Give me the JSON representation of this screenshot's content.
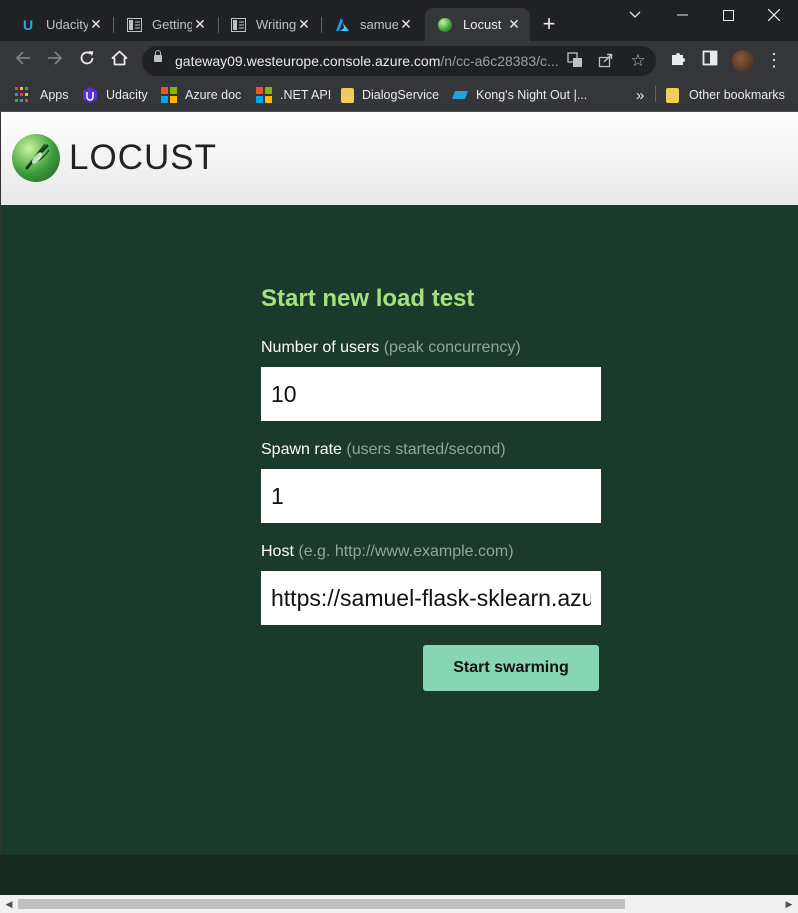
{
  "browser": {
    "tabs": [
      {
        "title": "Udacity",
        "icon": "udacity-icon"
      },
      {
        "title": "Getting",
        "icon": "doc-icon"
      },
      {
        "title": "Writing",
        "icon": "doc-icon"
      },
      {
        "title": "samuel",
        "icon": "azure-icon"
      },
      {
        "title": "Locust",
        "icon": "locust-icon",
        "active": true
      }
    ],
    "url_host": "gateway09.westeurope.console.azure.com",
    "url_rest": "/n/cc-a6c28383/c...",
    "bookmarks": [
      {
        "label": "Apps",
        "icon": "apps-grid-icon"
      },
      {
        "label": "Udacity",
        "icon": "udacity-icon"
      },
      {
        "label": "Azure doc",
        "icon": "microsoft-icon"
      },
      {
        "label": ".NET API",
        "icon": "microsoft-icon"
      },
      {
        "label": "DialogService",
        "icon": "folder-icon"
      },
      {
        "label": "Kong's Night Out |...",
        "icon": "kong-icon"
      }
    ],
    "other_bookmarks": "Other bookmarks",
    "overflow": "»"
  },
  "header": {
    "logo_text": "LOCUST"
  },
  "form": {
    "title": "Start new load test",
    "users_label": "Number of users",
    "users_hint": "(peak concurrency)",
    "users_value": "10",
    "spawn_label": "Spawn rate",
    "spawn_hint": "(users started/second)",
    "spawn_value": "1",
    "host_label": "Host",
    "host_hint": "(e.g. http://www.example.com)",
    "host_value": "https://samuel-flask-sklearn.azurewebsites.net",
    "submit_label": "Start swarming"
  },
  "colors": {
    "page_bg": "#1a3a2c",
    "title_green": "#a5e07f",
    "button_green": "#86d6b4"
  }
}
